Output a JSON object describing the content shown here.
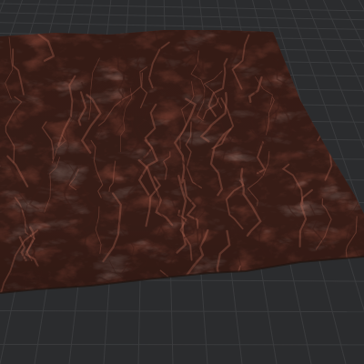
{
  "viewport": {
    "view": "perspective-3d",
    "background_color": "#2b2c2e",
    "grid": {
      "visible": true,
      "line_color": "#3b3c3e"
    },
    "terrain": {
      "material": "red-sandstone",
      "base_color": "#7a3f32",
      "highlight_color": "#b66a56",
      "shadow_color": "#3a1d18",
      "features": [
        "ridges",
        "canyons",
        "erosion-channels",
        "cliff-escarpment"
      ]
    }
  }
}
